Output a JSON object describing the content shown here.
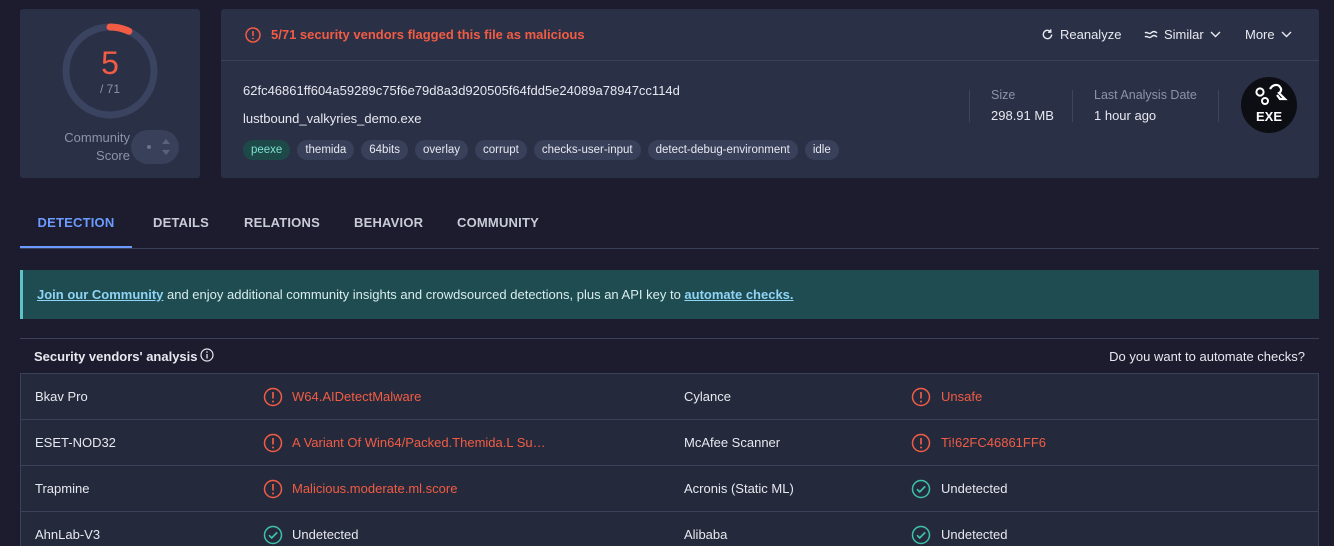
{
  "score": {
    "detections": "5",
    "total": "/ 71",
    "detection_fraction": 0.0704,
    "community_label_1": "Community",
    "community_label_2": "Score"
  },
  "alert": {
    "text": "5/71 security vendors flagged this file as malicious"
  },
  "actions": {
    "reanalyze": "Reanalyze",
    "similar": "Similar",
    "more": "More"
  },
  "file": {
    "hash": "62fc46861ff604a59289c75f6e79d8a3d920505f64fdd5e24089a78947cc114d",
    "name": "lustbound_valkyries_demo.exe",
    "tags": [
      "peexe",
      "themida",
      "64bits",
      "overlay",
      "corrupt",
      "checks-user-input",
      "detect-debug-environment",
      "idle"
    ],
    "size_label": "Size",
    "size_value": "298.91 MB",
    "date_label": "Last Analysis Date",
    "date_value": "1 hour ago",
    "type_badge": "EXE"
  },
  "tabs": [
    "DETECTION",
    "DETAILS",
    "RELATIONS",
    "BEHAVIOR",
    "COMMUNITY"
  ],
  "banner": {
    "link1": "Join our Community",
    "middle": " and enjoy additional community insights and crowdsourced detections, plus an API key to ",
    "link2": "automate checks."
  },
  "vendors": {
    "title": "Security vendors' analysis",
    "right_link": "Do you want to automate checks?",
    "rows": [
      [
        {
          "vendor": "Bkav Pro",
          "result": "W64.AIDetectMalware",
          "status": "malicious"
        },
        {
          "vendor": "Cylance",
          "result": "Unsafe",
          "status": "malicious"
        }
      ],
      [
        {
          "vendor": "ESET-NOD32",
          "result": "A Variant Of Win64/Packed.Themida.L Su…",
          "status": "malicious"
        },
        {
          "vendor": "McAfee Scanner",
          "result": "Ti!62FC46861FF6",
          "status": "malicious"
        }
      ],
      [
        {
          "vendor": "Trapmine",
          "result": "Malicious.moderate.ml.score",
          "status": "malicious"
        },
        {
          "vendor": "Acronis (Static ML)",
          "result": "Undetected",
          "status": "clean"
        }
      ],
      [
        {
          "vendor": "AhnLab-V3",
          "result": "Undetected",
          "status": "clean"
        },
        {
          "vendor": "Alibaba",
          "result": "Undetected",
          "status": "clean"
        }
      ]
    ]
  },
  "colors": {
    "malicious": "#f25c44",
    "clean": "#3ec2a7",
    "accent": "#6b9bff"
  }
}
